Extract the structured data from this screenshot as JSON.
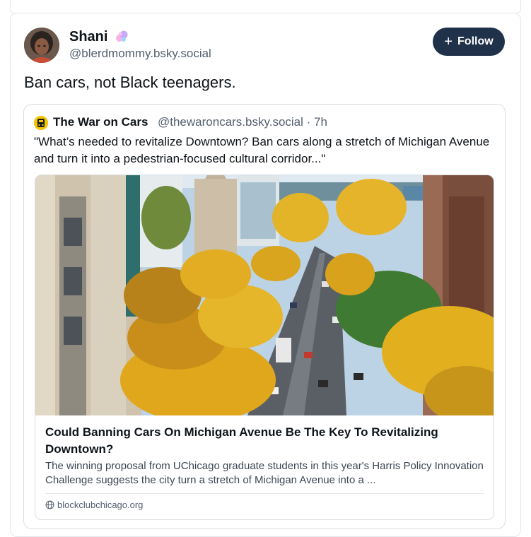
{
  "post": {
    "author_name": "Shani",
    "author_handle": "@blerdmommy.bsky.social",
    "follow_label": "Follow",
    "text": "Ban cars, not Black teenagers."
  },
  "quote": {
    "author_name": "The War on Cars",
    "author_handle": "@thewaroncars.bsky.social · 7h",
    "text": "\"What’s needed to revitalize Downtown? Ban cars along a stretch of Michigan Avenue and turn it into a pedestrian-focused cultural corridor...\""
  },
  "link_card": {
    "title": "Could Banning Cars On Michigan Avenue Be The Key To Revitalizing Downtown?",
    "description": "The winning proposal from UChicago graduate students in this year's Harris Policy Innovation Challenge suggests the city turn a stretch of Michigan Avenue into a ...",
    "domain": "blockclubchicago.org"
  },
  "icons": {
    "follow": "plus-icon",
    "badge": "butterfly-badge-icon",
    "domain": "globe-icon"
  },
  "colors": {
    "follow_button": "#20324a",
    "secondary_text": "#54606e",
    "border": "#e3e7ea"
  }
}
